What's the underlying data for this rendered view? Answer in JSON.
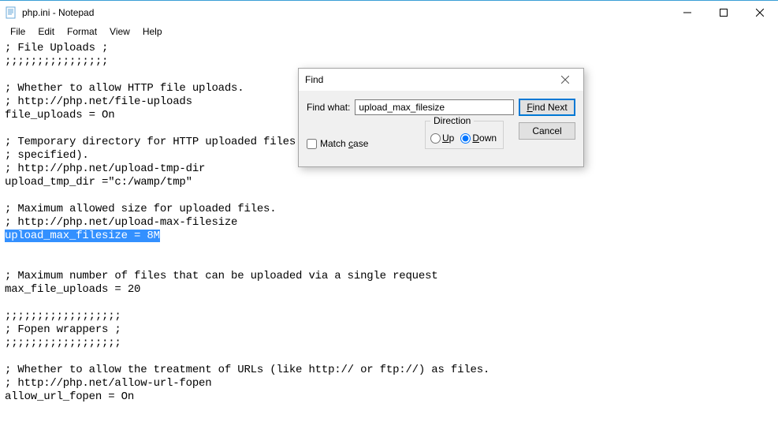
{
  "window": {
    "title": "php.ini - Notepad"
  },
  "menu": {
    "file": "File",
    "edit": "Edit",
    "format": "Format",
    "view": "View",
    "help": "Help"
  },
  "editor": {
    "lines": [
      "; File Uploads ;",
      ";;;;;;;;;;;;;;;;",
      "",
      "; Whether to allow HTTP file uploads.",
      "; http://php.net/file-uploads",
      "file_uploads = On",
      "",
      "; Temporary directory for HTTP uploaded files (will use system default if not",
      "; specified).",
      "; http://php.net/upload-tmp-dir",
      "upload_tmp_dir =\"c:/wamp/tmp\"",
      "",
      "; Maximum allowed size for uploaded files.",
      "; http://php.net/upload-max-filesize",
      "upload_max_filesize = 8M",
      "",
      "",
      "; Maximum number of files that can be uploaded via a single request",
      "max_file_uploads = 20",
      "",
      ";;;;;;;;;;;;;;;;;;",
      "; Fopen wrappers ;",
      ";;;;;;;;;;;;;;;;;;",
      "",
      "; Whether to allow the treatment of URLs (like http:// or ftp://) as files.",
      "; http://php.net/allow-url-fopen",
      "allow_url_fopen = On"
    ],
    "selected_line_index": 14
  },
  "find": {
    "title": "Find",
    "label": "Find what:",
    "value": "upload_max_filesize",
    "find_next": "Find Next",
    "cancel": "Cancel",
    "match_case": "Match case",
    "direction": "Direction",
    "up": "Up",
    "down": "Down",
    "selected_direction": "down"
  }
}
